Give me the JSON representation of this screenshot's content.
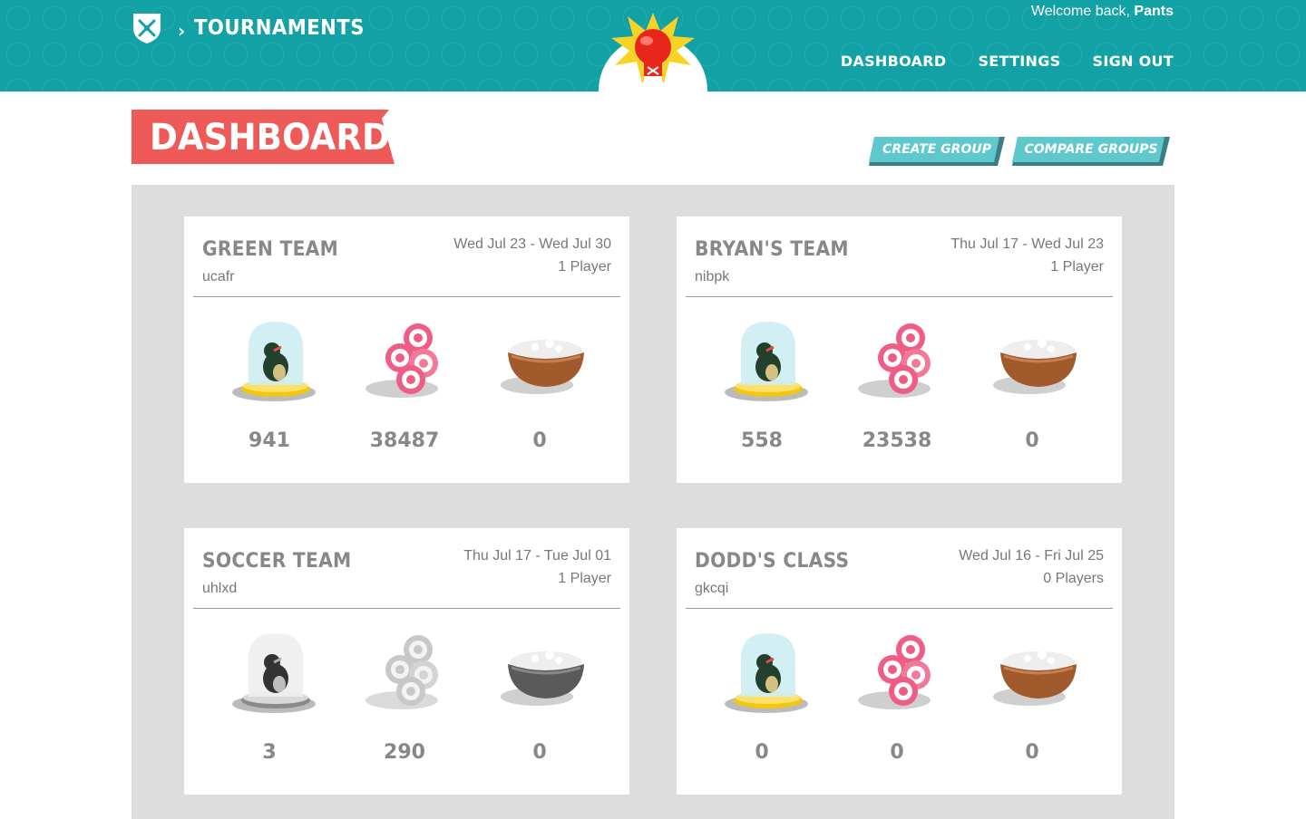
{
  "header": {
    "breadcrumb": "TOURNAMENTS",
    "welcome_prefix": "Welcome back, ",
    "username": "Pants",
    "nav": [
      "DASHBOARD",
      "SETTINGS",
      "SIGN OUT"
    ],
    "color": "#12a2a5"
  },
  "page": {
    "title": "DASHBOARD",
    "title_color": "#ee5a57",
    "buttons": {
      "create": "CREATE GROUP",
      "compare": "COMPARE GROUPS"
    },
    "button_color": "#5ec8cc"
  },
  "cards": [
    {
      "name": "GREEN TEAM",
      "code": "ucafr",
      "dates": "Wed Jul 23 - Wed Jul 30",
      "players": "1 Player",
      "stats": {
        "trophy": "941",
        "coins": "38487",
        "rice": "0"
      },
      "greyed": false
    },
    {
      "name": "BRYAN'S TEAM",
      "code": "nibpk",
      "dates": "Thu Jul 17 - Wed Jul 23",
      "players": "1 Player",
      "stats": {
        "trophy": "558",
        "coins": "23538",
        "rice": "0"
      },
      "greyed": false
    },
    {
      "name": "SOCCER TEAM",
      "code": "uhlxd",
      "dates": "Thu Jul 17 - Tue Jul 01",
      "players": "1 Player",
      "stats": {
        "trophy": "3",
        "coins": "290",
        "rice": "0"
      },
      "greyed": true
    },
    {
      "name": "DODD'S CLASS",
      "code": "gkcqi",
      "dates": "Wed Jul 16 - Fri Jul 25",
      "players": "0 Players",
      "stats": {
        "trophy": "0",
        "coins": "0",
        "rice": "0"
      },
      "greyed": false
    }
  ],
  "icons": {
    "logo": "leaf-shield-icon",
    "mascot": "boxing-glove-icon",
    "stat1": "trophy-dome-icon",
    "stat2": "candy-coins-icon",
    "stat3": "rice-bowl-icon"
  }
}
